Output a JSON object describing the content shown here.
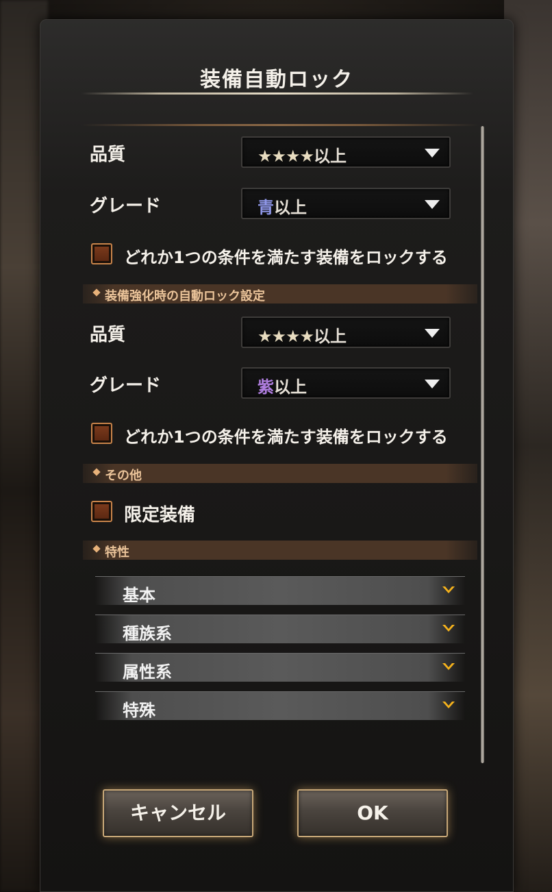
{
  "dialog": {
    "title": "装備自動ロック"
  },
  "lock_settings": {
    "quality_label": "品質",
    "quality_value_stars": "★★★★",
    "quality_value_suffix": "以上",
    "grade_label": "グレード",
    "grade_value_color": "青",
    "grade_value_suffix": "以上",
    "grade_color_hex": "#8f97e8",
    "any_condition_label": "どれか1つの条件を満たす装備をロックする"
  },
  "enhance_section": {
    "header": "装備強化時の自動ロック設定",
    "quality_label": "品質",
    "quality_value_stars": "★★★★",
    "quality_value_suffix": "以上",
    "grade_label": "グレード",
    "grade_value_color": "紫",
    "grade_value_suffix": "以上",
    "grade_color_hex": "#b07ee0",
    "any_condition_label": "どれか1つの条件を満たす装備をロックする"
  },
  "other_section": {
    "header": "その他",
    "limited_label": "限定装備"
  },
  "traits_section": {
    "header": "特性",
    "items": [
      {
        "label": "基本"
      },
      {
        "label": "種族系"
      },
      {
        "label": "属性系"
      },
      {
        "label": "特殊"
      }
    ]
  },
  "buttons": {
    "cancel": "キャンセル",
    "ok": "OK"
  },
  "icons": {
    "dropdown": "triangle-down-icon",
    "expand": "chevron-down-icon",
    "section_marker": "diamond-icon"
  },
  "colors": {
    "accent_gold": "#c8a878",
    "checkbox_border": "#c9844a",
    "chevron_gold": "#f5b21c"
  }
}
